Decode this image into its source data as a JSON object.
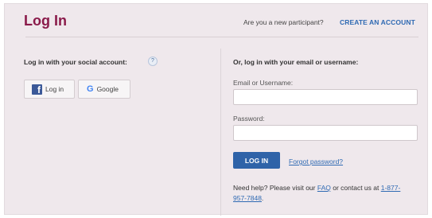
{
  "header": {
    "title": "Log In",
    "new_participant_text": "Are you a new participant?",
    "create_account_link": "CREATE AN ACCOUNT"
  },
  "social": {
    "heading": "Log in with your social account:",
    "help_badge": "?",
    "facebook_label": "Log in",
    "google_label": "Google"
  },
  "form": {
    "heading": "Or, log in with your email or username:",
    "username_label": "Email or Username:",
    "username_value": "",
    "password_label": "Password:",
    "password_value": "",
    "login_button": "LOG IN",
    "forgot_link": "Forgot password?"
  },
  "help": {
    "prefix": "Need help? Please visit our",
    "faq_link": "FAQ",
    "middle": "or contact us at",
    "phone_link": "1-877-957-7848",
    "suffix": "."
  },
  "colors": {
    "title": "#8a1a4a",
    "link": "#2f6ab3",
    "button": "#2f63a8",
    "panel_bg": "#efe8ec",
    "facebook": "#3b5998",
    "google": "#4285f4"
  },
  "icons": {
    "facebook": "facebook-icon",
    "google": "google-icon",
    "help": "help-icon"
  }
}
